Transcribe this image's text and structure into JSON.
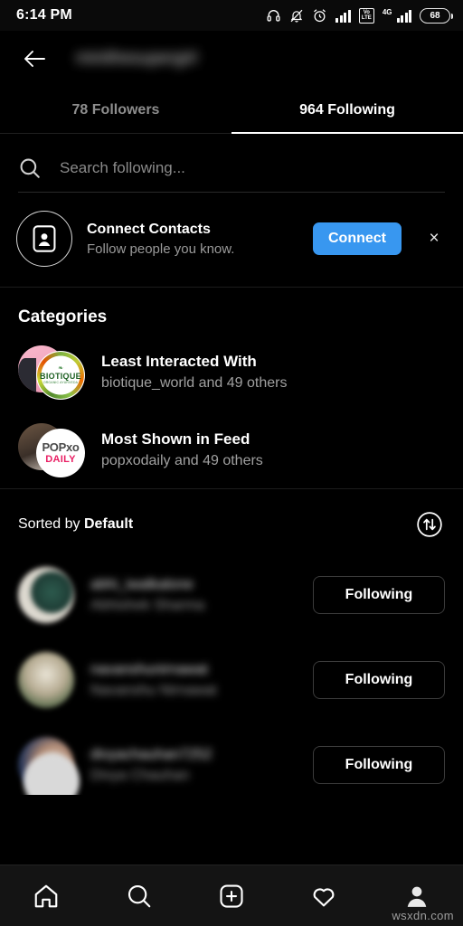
{
  "status_bar": {
    "time": "6:14 PM",
    "battery_percent": "68",
    "icons": [
      "headphones-icon",
      "bell-muted-icon",
      "alarm-clock-icon",
      "signal-bars-icon",
      "volte-icon",
      "4g-signal-icon",
      "battery-icon"
    ],
    "volte_label_top": "Vo",
    "volte_label_bottom": "LTE",
    "network_label": "4G"
  },
  "header": {
    "back_icon": "back-arrow-icon",
    "username": "minithesupergirl"
  },
  "tabs": [
    {
      "label": "78 Followers",
      "active": false
    },
    {
      "label": "964 Following",
      "active": true
    }
  ],
  "search": {
    "icon": "search-icon",
    "placeholder": "Search following...",
    "value": ""
  },
  "connect_contacts": {
    "icon": "contact-card-icon",
    "title": "Connect Contacts",
    "subtitle": "Follow people you know.",
    "button_label": "Connect",
    "button_color": "#3897f0",
    "dismiss_icon": "close-icon",
    "dismiss_label": "×"
  },
  "categories": {
    "section_title": "Categories",
    "items": [
      {
        "title": "Least Interacted With",
        "subtitle": "biotique_world and 49 others",
        "avatar_front_text": "BIOTIQUE",
        "avatar_front_subtext": "ORGANIC AYURVEDA",
        "avatar_back_color": "#f3aac0"
      },
      {
        "title": "Most Shown in Feed",
        "subtitle": "popxodaily and 49 others",
        "avatar_front_text": "POPxo",
        "avatar_front_subtext": "DAILY",
        "avatar_back_color": "#5a4638"
      }
    ]
  },
  "sort": {
    "prefix": "Sorted by ",
    "value": "Default",
    "icon": "sort-arrows-icon"
  },
  "user_list": [
    {
      "username": "abhi_iwalkalone",
      "fullname": "Abhishek Sharma",
      "button_label": "Following",
      "avatar_color": "#7e8a7d"
    },
    {
      "username": "navanshunirnawat",
      "fullname": "Navanshu Nirnawat",
      "button_label": "Following",
      "avatar_color": "#a39a86"
    },
    {
      "username": "divyachauhan7252",
      "fullname": "Divya Chauhan",
      "button_label": "Following",
      "avatar_color": "#3a4a66"
    }
  ],
  "bottom_nav": [
    {
      "icon": "home-icon",
      "active": false
    },
    {
      "icon": "search-icon",
      "active": false
    },
    {
      "icon": "add-post-icon",
      "active": false
    },
    {
      "icon": "heart-icon",
      "active": false
    },
    {
      "icon": "profile-icon",
      "active": true
    }
  ],
  "watermark": "wsxdn.com"
}
